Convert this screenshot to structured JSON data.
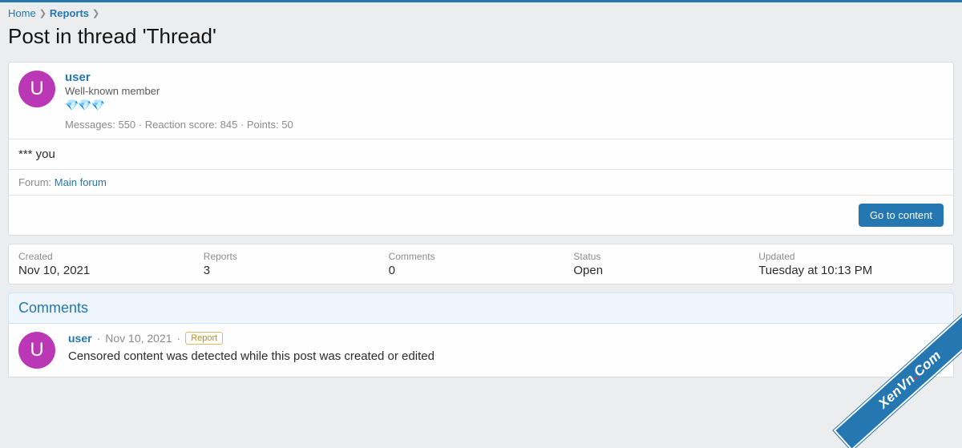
{
  "breadcrumb": {
    "home": "Home",
    "reports": "Reports"
  },
  "page_title": "Post in thread 'Thread'",
  "user": {
    "initial": "U",
    "name": "user",
    "title": "Well-known member",
    "gems": "💎💎💎",
    "stats": "Messages: 550 · Reaction score: 845 · Points: 50"
  },
  "post": {
    "content": "*** you",
    "forum_label": "Forum:",
    "forum_name": "Main forum"
  },
  "actions": {
    "go_to_content": "Go to content"
  },
  "stats": {
    "created": {
      "label": "Created",
      "value": "Nov 10, 2021"
    },
    "reports": {
      "label": "Reports",
      "value": "3"
    },
    "comments": {
      "label": "Comments",
      "value": "0"
    },
    "status": {
      "label": "Status",
      "value": "Open"
    },
    "updated": {
      "label": "Updated",
      "value": "Tuesday at 10:13 PM"
    }
  },
  "comments": {
    "header": "Comments",
    "item": {
      "initial": "U",
      "user": "user",
      "date": "Nov 10, 2021",
      "tag": "Report",
      "text": "Censored content was detected while this post was created or edited"
    }
  },
  "watermark": {
    "a": "XenVn",
    "b": "Com"
  }
}
